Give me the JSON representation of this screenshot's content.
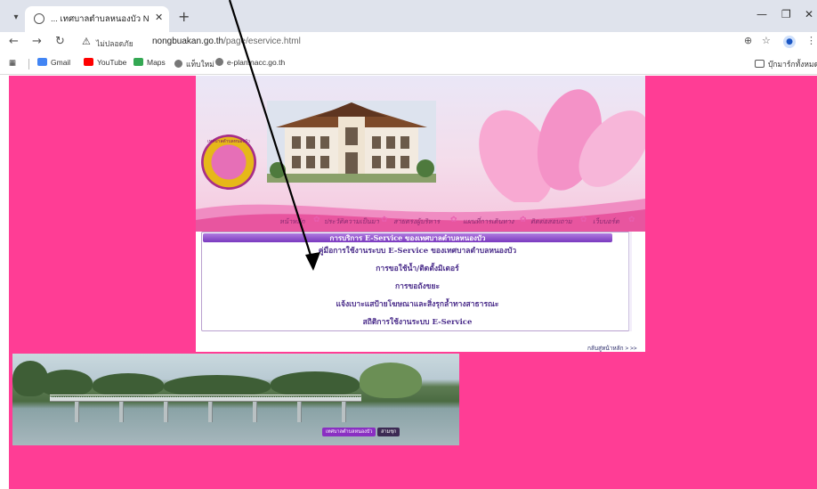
{
  "browser": {
    "tab_title": "... เทศบาลตำบลหนองบัว NoNGB",
    "url_host": "nongbuakan.go.th",
    "url_path": "/page/eservice.html",
    "security_label": "ไม่ปลอดภัย",
    "bookmarks": [
      "Gmail",
      "YouTube",
      "Maps",
      "แท็บใหม่",
      "e-plan.nacc.go.th"
    ],
    "bookmarks_right": "บุ๊กมาร์กทั้งหมด"
  },
  "colors": {
    "page_bg": "#ff3d95",
    "title_bar": "#7a39bf",
    "link_text": "#4a2c8a"
  },
  "banner": {
    "seal_text": "เทศบาลตำบลหนองบัว"
  },
  "nav": {
    "items": [
      "หน้าหลัก",
      "ประวัติความเป็นมา",
      "สายตรงผู้บริหาร",
      "แผนที่การเดินทาง",
      "ติดต่อสอบถาม",
      "เว็บบอร์ด"
    ]
  },
  "content": {
    "title": "การบริการ E-Service ของเทศบาลตำบลหนองบัว",
    "services": [
      "คู่มือการใช้งานระบบ E-Service ของเทศบาลตำบลหนองบัว",
      "การขอใช้น้ำ/ติดตั้งมิเตอร์",
      "การขอถังขยะ",
      "แจ้งเบาะแสป้ายโฆษณาและสิ่งรุกล้ำทางสาธารณะ",
      "สถิติการใช้งานระบบ E-Service"
    ],
    "back_link": "กลับสู่หน้าหลัก > >>"
  },
  "footer": {
    "badge_a": "เทศบาลตำบลหนองบัว",
    "badge_b": "สามชุก"
  }
}
